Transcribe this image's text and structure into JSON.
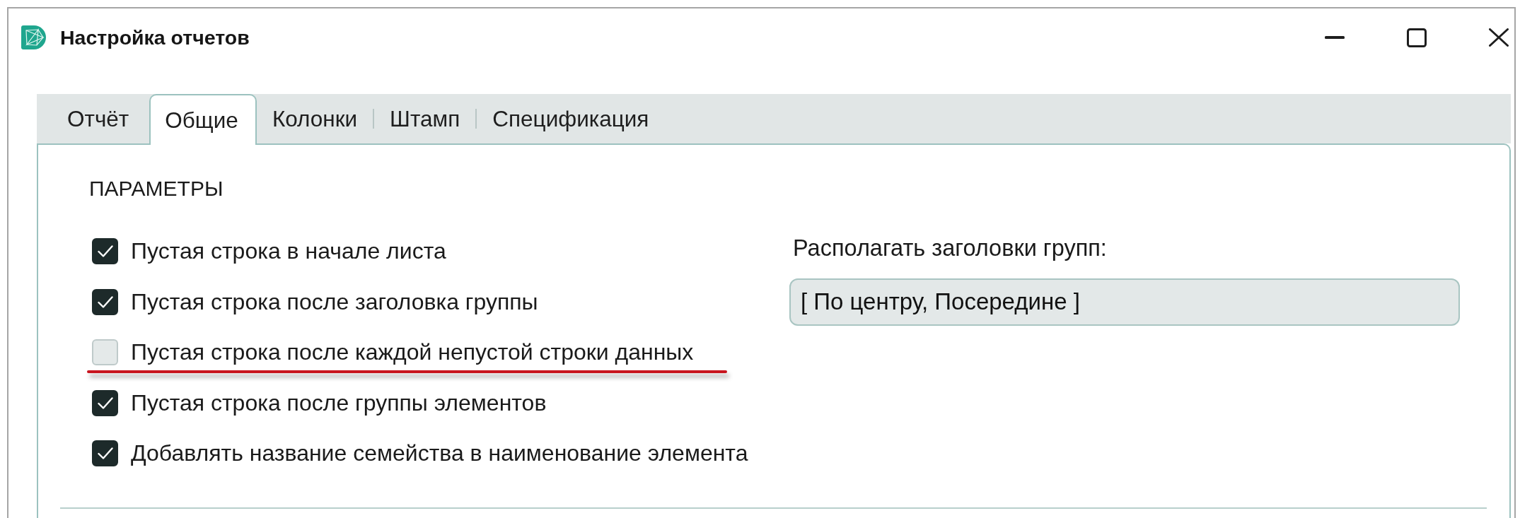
{
  "window": {
    "title": "Настройка отчетов"
  },
  "tabs": [
    {
      "label": "Отчёт",
      "selected": false
    },
    {
      "label": "Общие",
      "selected": true
    },
    {
      "label": "Колонки",
      "selected": false
    },
    {
      "label": "Штамп",
      "selected": false
    },
    {
      "label": "Спецификация",
      "selected": false
    }
  ],
  "section": {
    "title": "ПАРАМЕТРЫ"
  },
  "options": [
    {
      "label": "Пустая строка в начале листа",
      "checked": true,
      "underlined": false
    },
    {
      "label": "Пустая строка после заголовка группы",
      "checked": true,
      "underlined": false
    },
    {
      "label": "Пустая строка после каждой непустой строки данных",
      "checked": false,
      "underlined": true
    },
    {
      "label": "Пустая строка после группы элементов",
      "checked": true,
      "underlined": false
    },
    {
      "label": "Добавлять название семейства в наименование элемента",
      "checked": true,
      "underlined": false
    }
  ],
  "group_headers": {
    "label": "Располагать заголовки групп:",
    "value": "[ По центру, Посередине ]"
  }
}
